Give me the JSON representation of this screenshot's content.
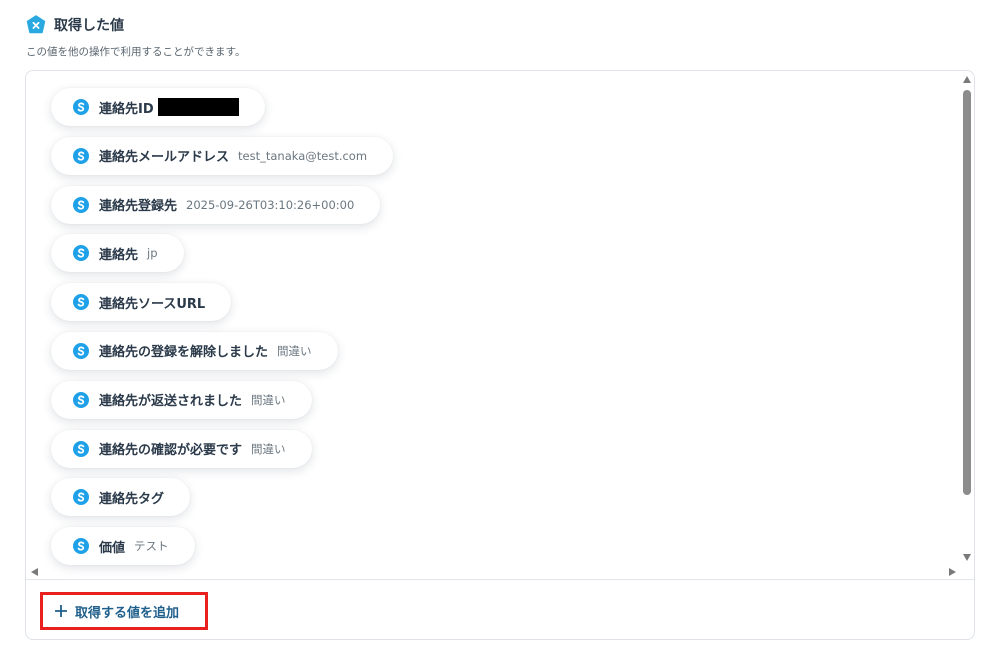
{
  "header": {
    "icon": "yoom-pentagon-icon",
    "title": "取得した値",
    "subtitle": "この値を他の操作で利用することができます。"
  },
  "fields": [
    {
      "label": "連絡先ID",
      "value": "",
      "redacted": true
    },
    {
      "label": "連絡先メールアドレス",
      "value": "test_tanaka@test.com"
    },
    {
      "label": "連絡先登録先",
      "value": "2025-09-26T03:10:26+00:00"
    },
    {
      "label": "連絡先",
      "value": "jp"
    },
    {
      "label": "連絡先ソースURL",
      "value": ""
    },
    {
      "label": "連絡先の登録を解除しました",
      "value": "間違い"
    },
    {
      "label": "連絡先が返送されました",
      "value": "間違い"
    },
    {
      "label": "連絡先の確認が必要です",
      "value": "間違い"
    },
    {
      "label": "連絡先タグ",
      "value": ""
    },
    {
      "label": "価値",
      "value": "テスト"
    }
  ],
  "field_icon": "s-circle-icon",
  "add_button": {
    "label": "取得する値を追加",
    "icon": "plus-icon"
  },
  "colors": {
    "field_icon_bg": "#1ea1e8",
    "header_icon_bg": "#2aa8e0",
    "add_button_text": "#1f5f8b",
    "highlight_border": "#e8201e"
  }
}
